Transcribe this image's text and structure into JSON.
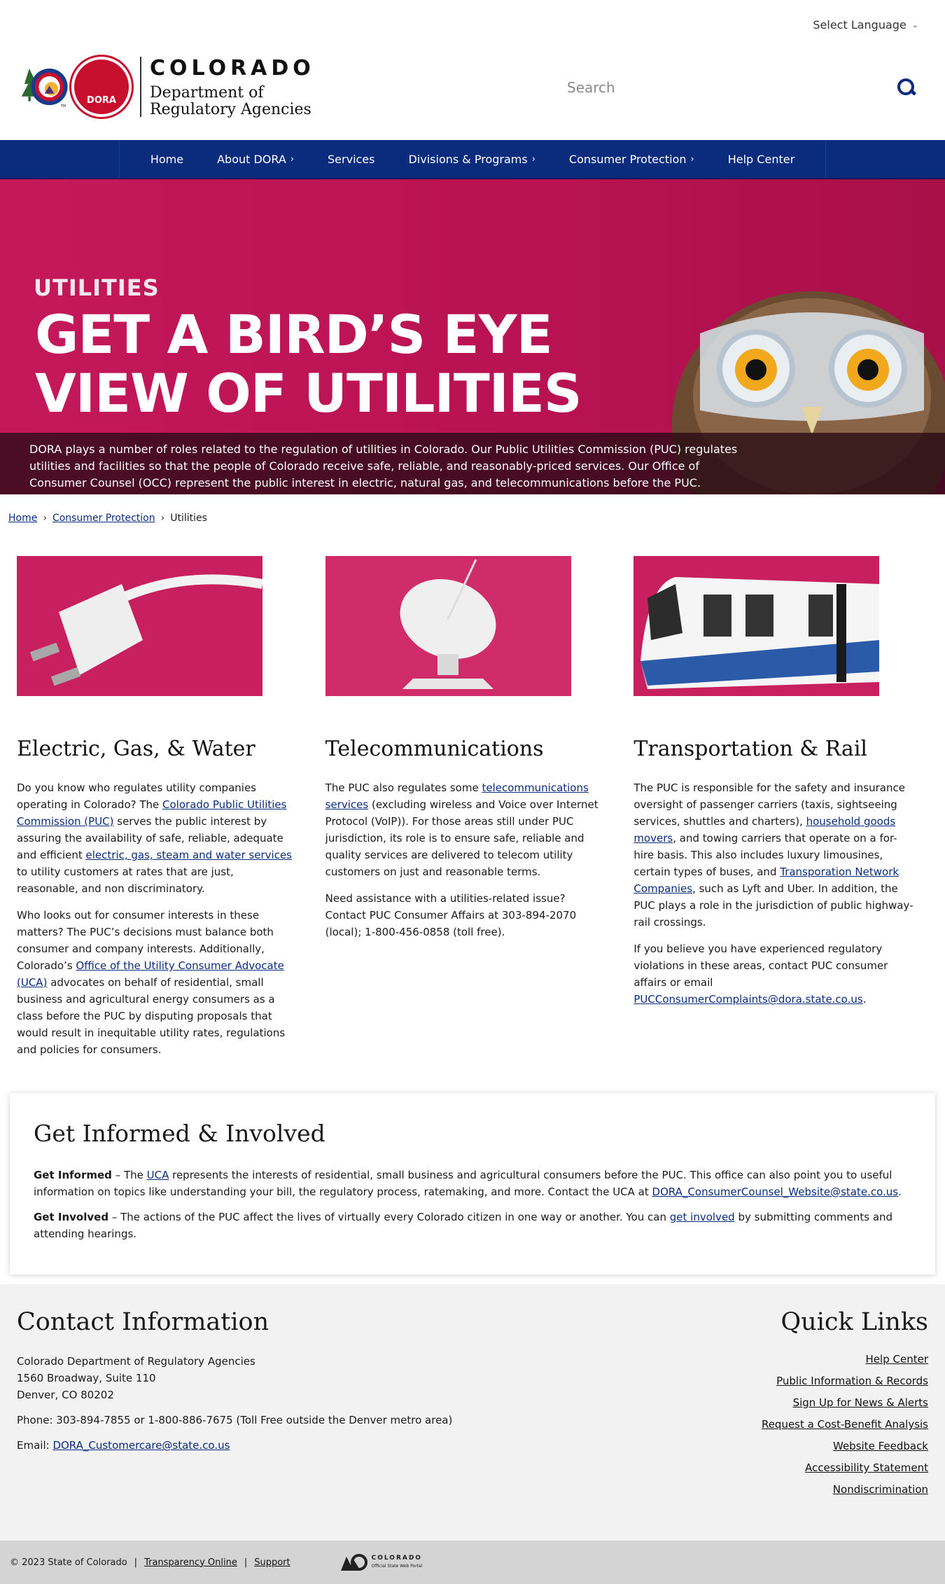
{
  "header": {
    "language_label": "Select Language",
    "logo": {
      "state": "COLORADO",
      "dept_line1": "Department of",
      "dept_line2": "Regulatory Agencies",
      "badge": "DORA",
      "tm": "TM"
    },
    "search_placeholder": "Search"
  },
  "nav": {
    "items": [
      {
        "label": "Home"
      },
      {
        "label": "About DORA",
        "arrow": "›"
      },
      {
        "label": "Services"
      },
      {
        "label": "Divisions & Programs",
        "arrow": "›"
      },
      {
        "label": "Consumer Protection",
        "arrow": "›"
      },
      {
        "label": "Help Center"
      }
    ]
  },
  "hero": {
    "kicker": "UTILITIES",
    "headline_line1": "GET A BIRD’S EYE",
    "headline_line2": "VIEW OF UTILITIES",
    "caption": "DORA plays a number of roles related to the regulation of utilities in Colorado. Our Public Utilities Commission (PUC) regulates utilities and facilities so that the people of Colorado receive safe, reliable, and reasonably-priced services. Our Office of Consumer Counsel (OCC) represent the public interest in electric, natural gas, and telecommunications before the PUC."
  },
  "breadcrumb": {
    "home": "Home",
    "sep": "›",
    "parent": "Consumer Protection",
    "current": "Utilities"
  },
  "cards": {
    "electric": {
      "title": "Electric, Gas, & Water",
      "p1_a": "Do you know who regulates utility companies operating in Colorado? The ",
      "p1_link1": "Colorado Public Utilities Commission (PUC)",
      "p1_b": " serves the public interest by assuring the availability of safe, reliable, adequate and efficient ",
      "p1_link2": "electric, gas, steam and water services",
      "p1_c": " to utility customers at rates that are just, reasonable, and non discriminatory.",
      "p2_a": "Who looks out for consumer interests in these matters? The PUC’s decisions must balance both consumer and company interests. Additionally, Colorado’s ",
      "p2_link": "Office of the Utility Consumer Advocate (UCA)",
      "p2_b": " advocates on behalf of residential, small business and agricultural energy consumers as a class before the PUC by disputing proposals that would result in inequitable utility rates, regulations and policies for consumers."
    },
    "telecom": {
      "title": "Telecommunications",
      "p1_a": "The PUC also regulates some ",
      "p1_link": "telecommunications services",
      "p1_b": " (excluding wireless and Voice over Internet Protocol (VoIP)). For those areas still under PUC jurisdiction, its role is to ensure safe, reliable and quality services are delivered to telecom utility customers on just and reasonable terms.",
      "p2": "Need assistance with a utilities-related issue? Contact PUC Consumer Affairs at 303-894-2070 (local); 1-800-456-0858 (toll free)."
    },
    "transport": {
      "title": "Transportation & Rail",
      "p1_a": "The PUC is responsible for the safety and insurance oversight of passenger carriers (taxis, sightseeing services, shuttles and charters), ",
      "p1_link1": "household goods movers",
      "p1_b": ", and towing carriers that operate on a for-hire basis. This also includes luxury limousines, certain types of buses, and ",
      "p1_link2": "Transporation Network Companies",
      "p1_c": ", such as Lyft and Uber. In addition, the PUC plays a role in the jurisdiction of public highway-rail crossings.",
      "p2_a": "If you believe you have experienced regulatory violations in these areas, contact PUC consumer affairs or email ",
      "p2_link": "PUCConsumerComplaints@dora.state.co.us",
      "p2_b": "."
    }
  },
  "informed": {
    "title": "Get Informed & Involved",
    "p1_label": "Get Informed",
    "p1_a": " – The ",
    "p1_link1": "UCA",
    "p1_b": " represents the interests of residential, small business and agricultural consumers before the PUC. This office can also point you to useful information on topics like understanding your bill, the regulatory process, ratemaking, and more. Contact the UCA at ",
    "p1_link2": "DORA_ConsumerCounsel_Website@state.co.us",
    "p1_c": ".",
    "p2_label": "Get Involved",
    "p2_a": " – The actions of the PUC affect the lives of virtually every Colorado citizen in one way or another. You can ",
    "p2_link": "get involved",
    "p2_b": " by submitting comments and attending hearings."
  },
  "footer": {
    "contact_title": "Contact Information",
    "org": "Colorado Department of Regulatory Agencies",
    "street": "1560 Broadway, Suite 110",
    "city": "Denver, CO 80202",
    "phone": "Phone: 303-894-7855 or 1-800-886-7675 (Toll Free outside the Denver metro area)",
    "email_label": "Email: ",
    "email": "DORA_Customercare@state.co.us",
    "quick_title": "Quick Links",
    "quick_links": [
      "Help Center",
      "Public Information & Records",
      "Sign Up for News & Alerts",
      "Request a Cost-Benefit Analysis",
      "Website Feedback",
      "Accessibility Statement",
      "Nondiscrimination"
    ]
  },
  "bottom": {
    "copyright": "© 2023 State of Colorado",
    "sep": "|",
    "transparency": "Transparency Online",
    "support": "Support",
    "portal_name": "COLORADO",
    "portal_sub": "Official State Web Portal"
  }
}
